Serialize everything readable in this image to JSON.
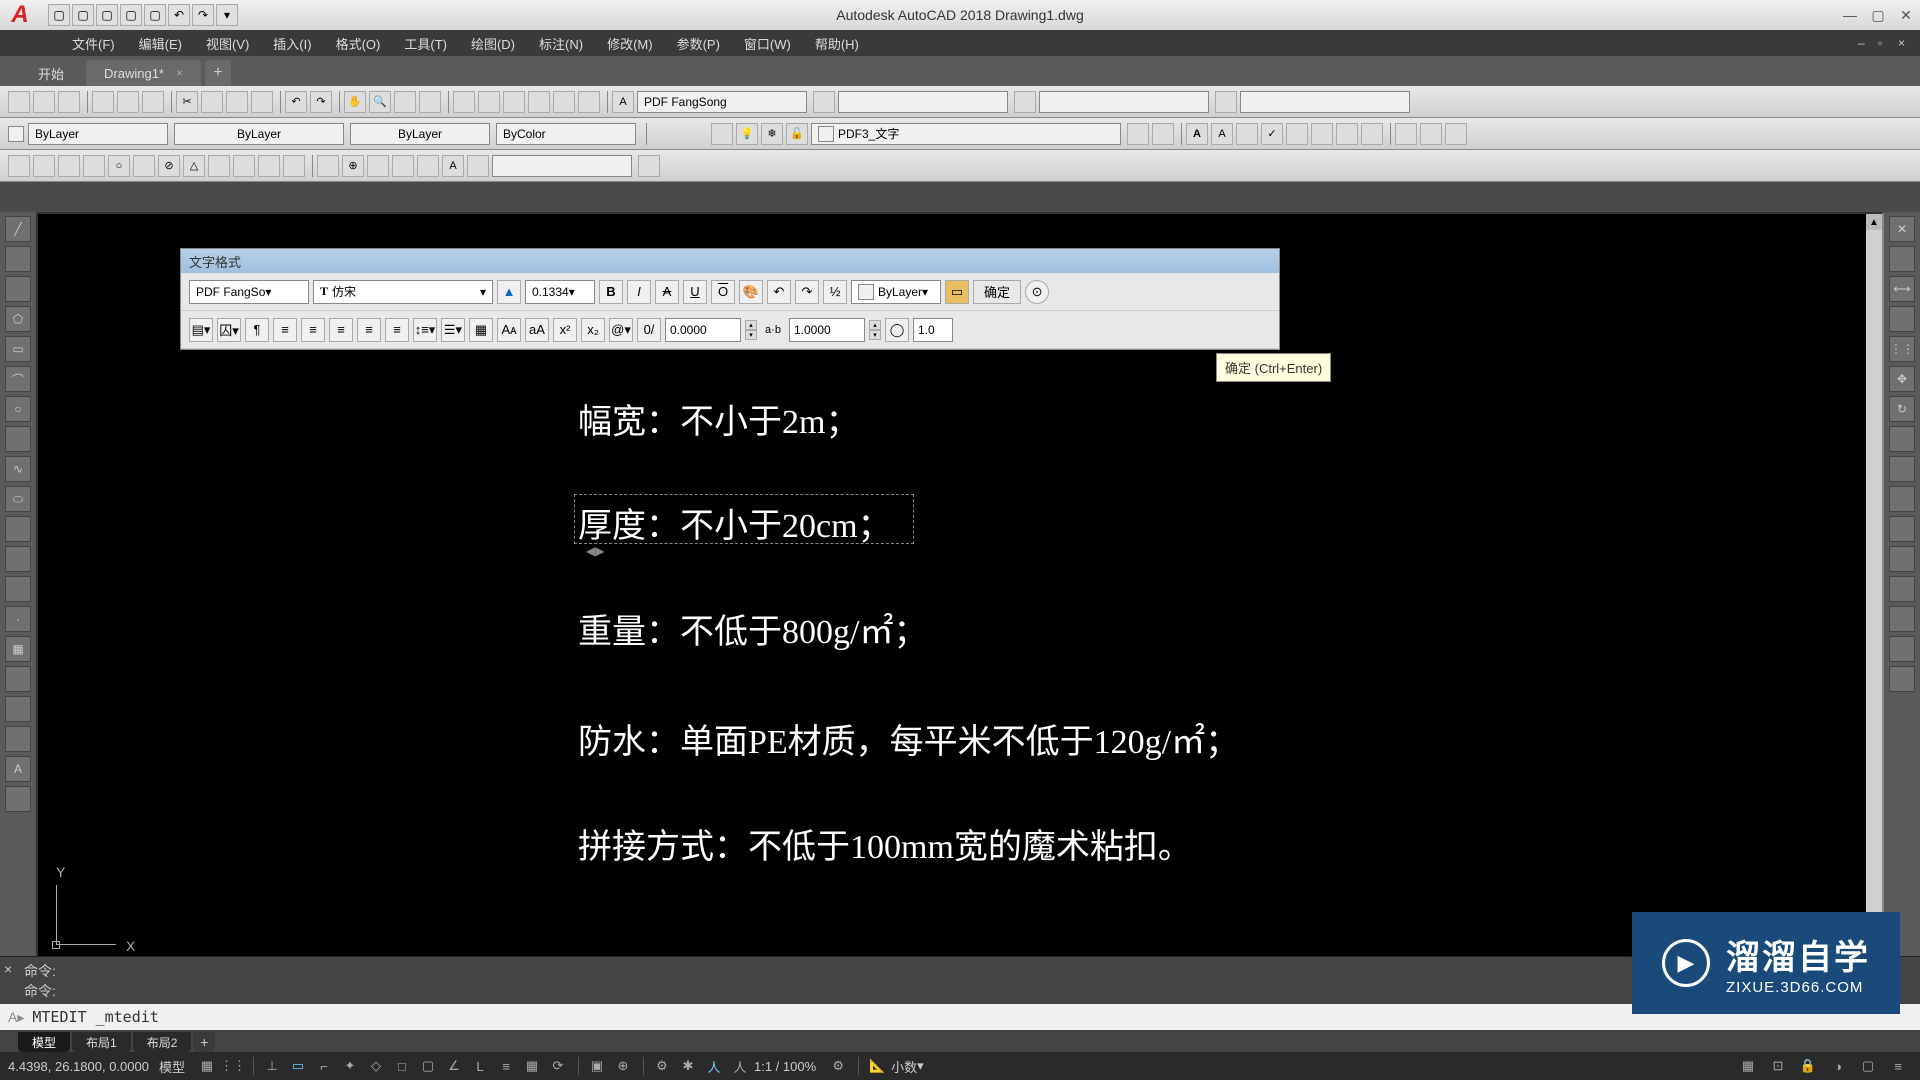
{
  "title": "Autodesk AutoCAD 2018   Drawing1.dwg",
  "menus": [
    "文件(F)",
    "编辑(E)",
    "视图(V)",
    "插入(I)",
    "格式(O)",
    "工具(T)",
    "绘图(D)",
    "标注(N)",
    "修改(M)",
    "参数(P)",
    "窗口(W)",
    "帮助(H)"
  ],
  "tabs": {
    "start": "开始",
    "drawing": "Drawing1*"
  },
  "toolbar": {
    "font_combo": "PDF FangSong",
    "layer_props": {
      "bylayer": "ByLayer",
      "bycolor": "ByColor"
    },
    "layer_combo": "PDF3_文字"
  },
  "textfmt": {
    "title": "文字格式",
    "style_combo": "PDF FangSo",
    "font_combo": "仿宋",
    "height": "0.1334",
    "color_combo": "ByLayer",
    "ok": "确定",
    "oblique": "0.0000",
    "tracking": "1.0000",
    "width_factor": "1.0"
  },
  "tooltip": "确定 (Ctrl+Enter)",
  "mtext": {
    "l1": "幅宽：不小于2m；",
    "l2": "厚度：不小于20cm；",
    "l3": "重量：不低于800g/㎡；",
    "l4": "防水：单面PE材质，每平米不低于120g/㎡；",
    "l5": "拼接方式：不低于100mm宽的魔术粘扣。"
  },
  "cmd": {
    "hist1": "命令:",
    "hist2": "命令:",
    "input": "MTEDIT _mtedit"
  },
  "model_tabs": {
    "model": "模型",
    "layout1": "布局1",
    "layout2": "布局2"
  },
  "status": {
    "coords": "4.4398, 26.1800, 0.0000",
    "model": "模型",
    "scale": "1:1 / 100%",
    "numtype": "小数"
  },
  "watermark": {
    "main": "溜溜自学",
    "sub": "ZIXUE.3D66.COM"
  },
  "ucs": {
    "y": "Y",
    "x": "X"
  },
  "labels": {
    "ab": "a·b"
  }
}
